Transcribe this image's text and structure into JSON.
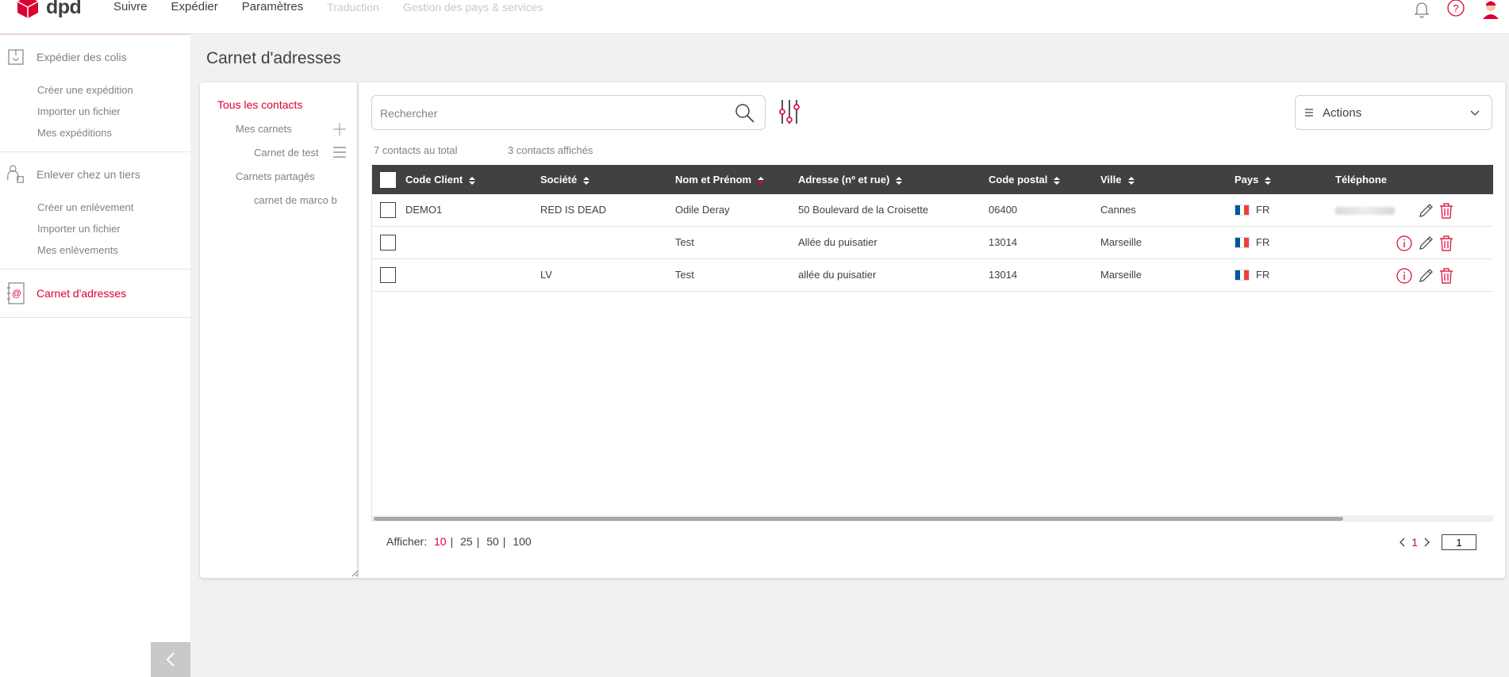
{
  "app": {
    "logo_text": "dpd",
    "nav": [
      "Suivre",
      "Expédier",
      "Paramètres",
      "Traduction",
      "Gestion des pays & services"
    ]
  },
  "sidebar": {
    "sections": [
      {
        "title": "Expédier des colis",
        "icon": "parcel-icon",
        "links": [
          "Créer une expédition",
          "Importer un fichier",
          "Mes expéditions"
        ]
      },
      {
        "title": "Enlever chez un tiers",
        "icon": "pickup-person-icon",
        "links": [
          "Créer un enlèvement",
          "Importer un fichier",
          "Mes enlèvements"
        ]
      },
      {
        "title": "Carnet d'adresses",
        "icon": "address-book-icon",
        "links": []
      }
    ]
  },
  "page": {
    "title": "Carnet d'adresses"
  },
  "tree": {
    "root": "Tous les contacts",
    "my_books": "Mes carnets",
    "book_test": "Carnet de test",
    "shared": "Carnets partagés",
    "book_marco": "carnet de marco b"
  },
  "search": {
    "placeholder": "Rechercher"
  },
  "actions": {
    "label": "Actions"
  },
  "counts": {
    "total": "7 contacts au total",
    "shown": "3 contacts affichés"
  },
  "table": {
    "columns": [
      "Code Client",
      "Société",
      "Nom et Prénom",
      "Adresse (nº et rue)",
      "Code postal",
      "Ville",
      "Pays",
      "Téléphone"
    ],
    "rows": [
      {
        "code": "DEMO1",
        "societe": "RED IS DEAD",
        "nom": "Odile Deray",
        "adresse": "50 Boulevard de la Croisette",
        "cp": "06400",
        "ville": "Cannes",
        "pays": "FR"
      },
      {
        "code": "",
        "societe": "",
        "nom": "Test",
        "adresse": "Allée du puisatier",
        "cp": "13014",
        "ville": "Marseille",
        "pays": "FR"
      },
      {
        "code": "",
        "societe": "LV",
        "nom": "Test",
        "adresse": "allée du puisatier",
        "cp": "13014",
        "ville": "Marseille",
        "pays": "FR"
      }
    ]
  },
  "pager": {
    "label": "Afficher:",
    "options": [
      "10",
      "25",
      "50",
      "100"
    ],
    "current_page": "1",
    "page_input": "1"
  },
  "colors": {
    "accent": "#dc0032",
    "header_bg": "#414042"
  }
}
